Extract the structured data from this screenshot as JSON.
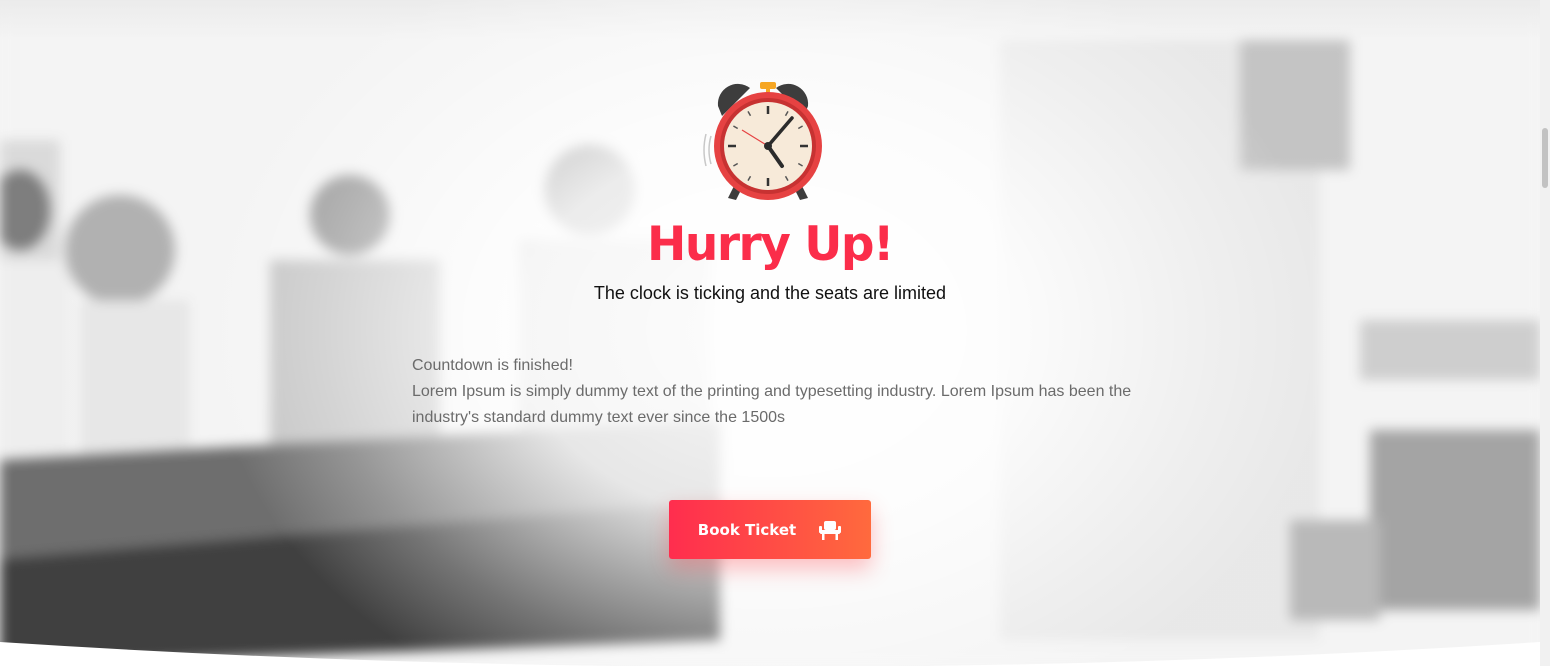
{
  "hero": {
    "icon": "alarm-clock-icon",
    "title": "Hurry Up!",
    "subtitle": "The clock is ticking and the seats are limited",
    "countdown_status": "Countdown is finished!",
    "description": "Lorem Ipsum is simply dummy text of the printing and typesetting industry. Lorem Ipsum has been the industry's standard dummy text ever since the 1500s",
    "cta_label": "Book Ticket",
    "cta_icon": "seat-icon"
  },
  "colors": {
    "accent": "#fb2d4a",
    "button_gradient_start": "#ff2d4e",
    "button_gradient_end": "#ff6a3d"
  }
}
